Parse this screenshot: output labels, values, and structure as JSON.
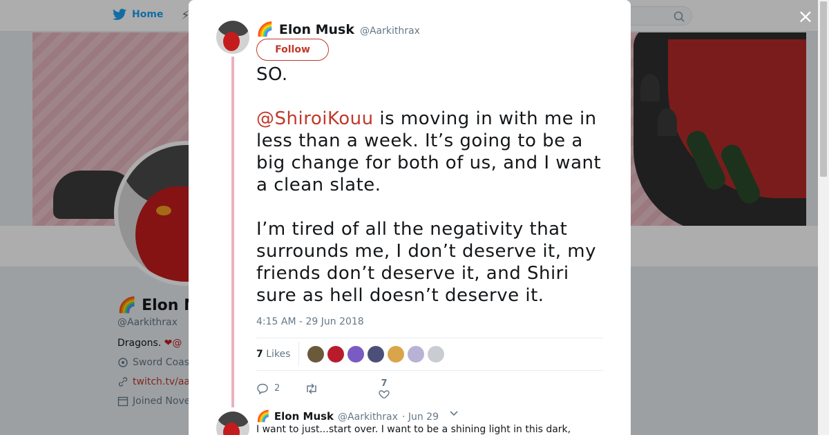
{
  "nav": {
    "home_label": "Home"
  },
  "profile": {
    "name": "Elon M",
    "handle": "@Aarkithrax",
    "bio_text": "Dragons.",
    "bio_tail": "@",
    "location": "Sword Coas",
    "link": "twitch.tv/aa",
    "joined": "Joined Nove"
  },
  "modal": {
    "close_icon": "×",
    "author": {
      "name": "Elon Musk",
      "handle": "@Aarkithrax",
      "emoji": "🌈"
    },
    "follow_label": "Follow",
    "tweet": {
      "line1": "SO.",
      "mention": "@ShiroiKouu",
      "para2": " is moving in with me in less than a week. It’s going to be a big change for both of us, and I want a clean slate.",
      "para3": "I’m tired of all the negativity that surrounds me, I don’t deserve it, my friends don’t deserve it, and Shiri sure as hell doesn’t deserve it."
    },
    "timestamp": "4:15 AM - 29 Jun 2018",
    "likes_count": "7",
    "likes_label": "Likes",
    "liker_colors": [
      "#6b5a3a",
      "#b81c2c",
      "#7a5bc4",
      "#4b4f7a",
      "#d9a54a",
      "#b7b2d6",
      "#c9cdd2"
    ],
    "actions": {
      "reply_count": "2",
      "retweet_count": "",
      "like_count": "7"
    },
    "reply": {
      "emoji": "🌈",
      "name": "Elon Musk",
      "handle": "@Aarkithrax",
      "date": "· Jun 29",
      "text": "I want to just...start over. I want to be a shining light in this dark,"
    }
  },
  "colors": {
    "accent": "#c0392b",
    "link_blue": "#1da1f2",
    "thread": "#eab2bb"
  }
}
